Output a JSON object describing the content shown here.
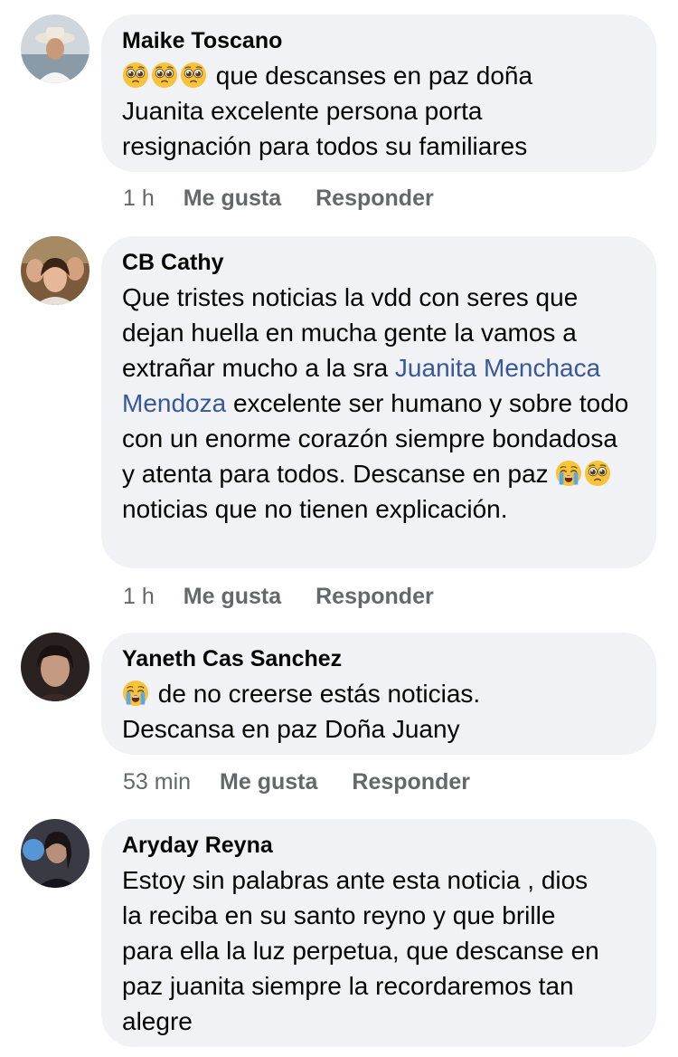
{
  "comments": [
    {
      "author": "Maike Toscano",
      "emojis": [
        "pleading-face",
        "pleading-face",
        "pleading-face"
      ],
      "lines": [
        " que descanses en paz doña",
        "Juanita excelente persona porta",
        "resignación para todos su familiares"
      ],
      "time": "1 h",
      "like_label": "Me gusta",
      "reply_label": "Responder"
    },
    {
      "author": "CB Cathy",
      "text_part1": "Que tristes noticias la vdd con seres que dejan huella en mucha gente la vamos a extrañar mucho a la sra ",
      "mention": "Juanita Menchaca Mendoza",
      "text_part2": " excelente ser humano y sobre todo con un enorme corazón siempre bondadosa y atenta para todos. Descanse en paz ",
      "emojis": [
        "crying-face",
        "pleading-face"
      ],
      "text_part3": " noticias que no tienen explicación.",
      "time": "1 h",
      "like_label": "Me gusta",
      "reply_label": "Responder"
    },
    {
      "author": "Yaneth Cas Sanchez",
      "emojis": [
        "crying-face"
      ],
      "lines": [
        " de no creerse estás noticias.",
        "Descansa en paz Doña Juany"
      ],
      "time": "53 min",
      "like_label": "Me gusta",
      "reply_label": "Responder"
    },
    {
      "author": "Aryday Reyna",
      "lines": [
        "Estoy sin palabras ante esta noticia , dios",
        "la reciba en su santo reyno y que brille",
        "para ella la luz perpetua, que descanse en",
        "paz juanita siempre la recordaremos tan",
        "alegre"
      ]
    }
  ],
  "colors": {
    "bubble": "#f0f2f5",
    "mention": "#385898",
    "meta": "#65676b",
    "text": "#050505"
  }
}
